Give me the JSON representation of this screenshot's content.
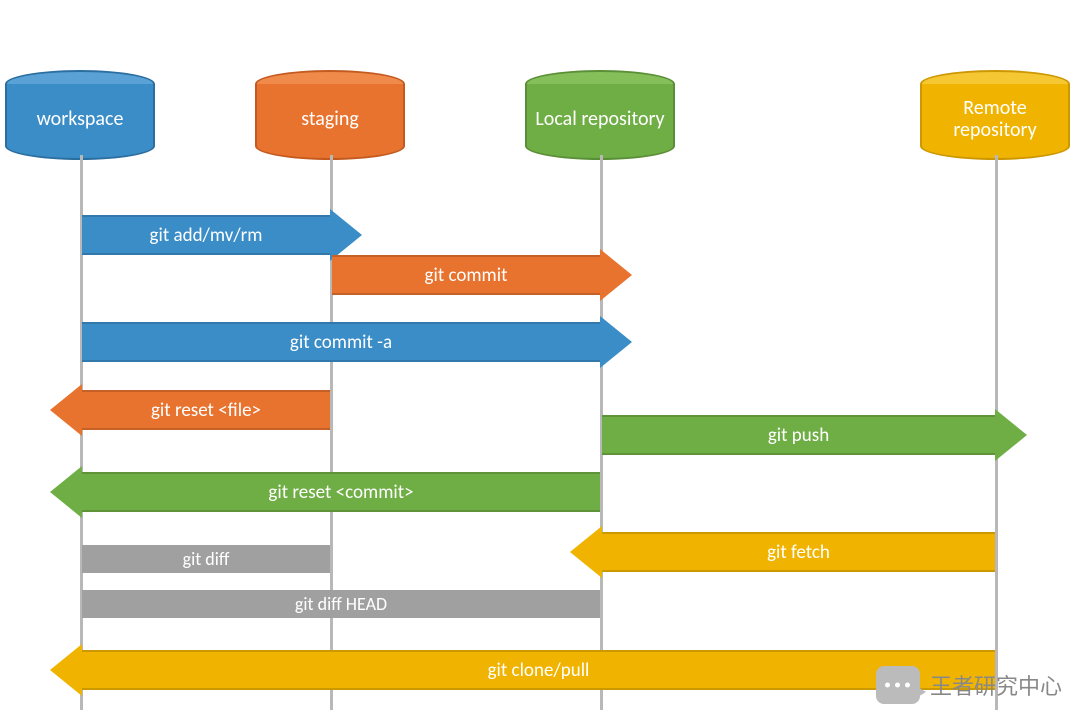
{
  "actors": {
    "workspace": "workspace",
    "staging": "staging",
    "local": "Local repository",
    "remote": "Remote repository"
  },
  "arrows": {
    "add": "git add/mv/rm",
    "commit": "git commit",
    "commit_a": "git commit -a",
    "reset_file": "git reset <file>",
    "push": "git push",
    "reset_commit": "git reset <commit>",
    "fetch": "git fetch",
    "diff": "git diff",
    "diff_head": "git diff HEAD",
    "clone_pull": "git clone/pull"
  },
  "watermark": "王者研究中心"
}
